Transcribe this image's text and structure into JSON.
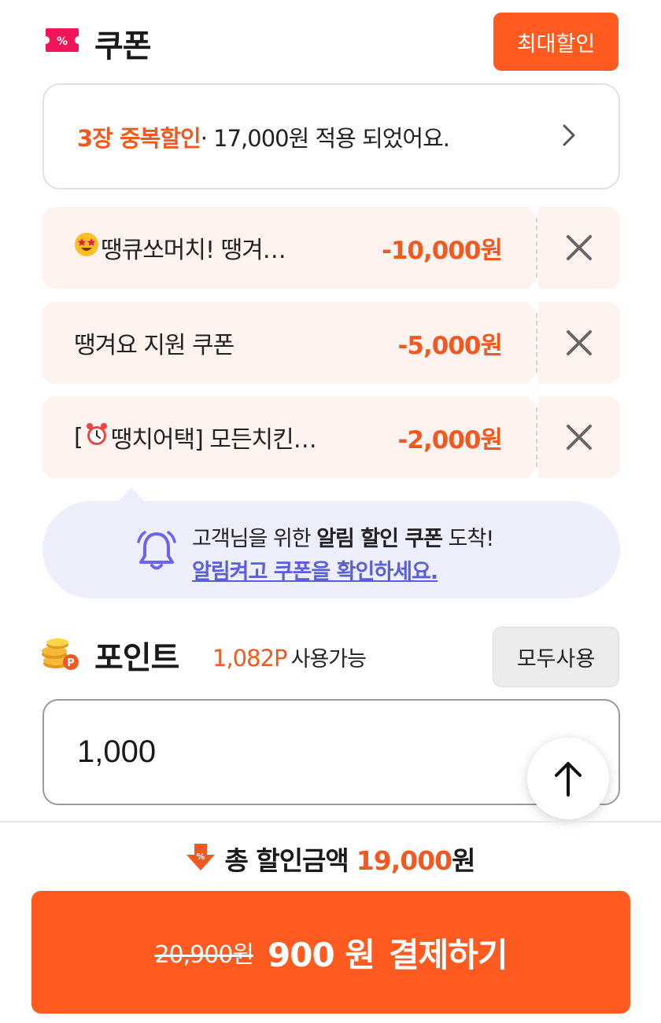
{
  "coupon": {
    "title": "쿠폰",
    "max_discount_button": "최대할인",
    "summary": {
      "highlight": "3장 중복할인",
      "rest": "· 17,000원 적용 되었어요."
    },
    "items": [
      {
        "name": "땡큐쏘머치! 땡겨…",
        "amount": "-10,000원",
        "icon": "star-eyes-emoji"
      },
      {
        "name": "땡겨요 지원 쿠폰",
        "amount": "-5,000원"
      },
      {
        "name_prefix": "[",
        "name": "땡치어택] 모든치킨…",
        "amount": "-2,000원",
        "icon": "alarm-clock-emoji"
      }
    ],
    "notice": {
      "line1_pre": "고객님을 위한 ",
      "line1_bold": "알림 할인 쿠폰",
      "line1_post": " 도착!",
      "line2_link": "알림켜고 쿠폰을 확인하세요."
    }
  },
  "points": {
    "title": "포인트",
    "available_amount": "1,082P",
    "available_label": "사용가능",
    "use_all_button": "모두사용",
    "input_value": "1,000"
  },
  "footer": {
    "total_label": "총 할인금액",
    "total_amount": "19,000",
    "total_unit": "원",
    "pay_original": "20,900원",
    "pay_amount": "900 원",
    "pay_label": "결제하기"
  },
  "colors": {
    "accent": "#ff5a1f",
    "discount_text": "#f05a22",
    "coupon_bg": "#fff3ef",
    "notice_bg": "#eeeffd",
    "notice_link": "#5a5fd8"
  }
}
